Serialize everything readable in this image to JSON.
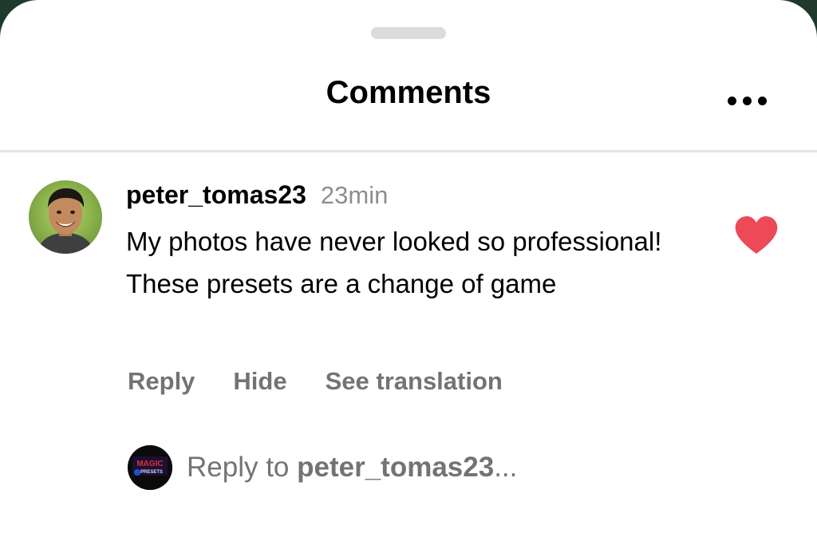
{
  "sheet": {
    "title": "Comments",
    "more_icon": "more-horizontal-icon"
  },
  "comment": {
    "username": "peter_tomas23",
    "time": "23min",
    "text": "My photos have never looked so professional! These presets are a change of game",
    "liked": true,
    "like_icon": "heart-filled-icon",
    "like_color": "#ed4956",
    "actions": {
      "reply": "Reply",
      "hide": "Hide",
      "translate": "See translation"
    }
  },
  "reply_box": {
    "prefix": "Reply to ",
    "target": "peter_tomas23",
    "suffix": "...",
    "my_avatar_text_top": "MAGIC",
    "my_avatar_text_bottom": "PRESETS"
  }
}
